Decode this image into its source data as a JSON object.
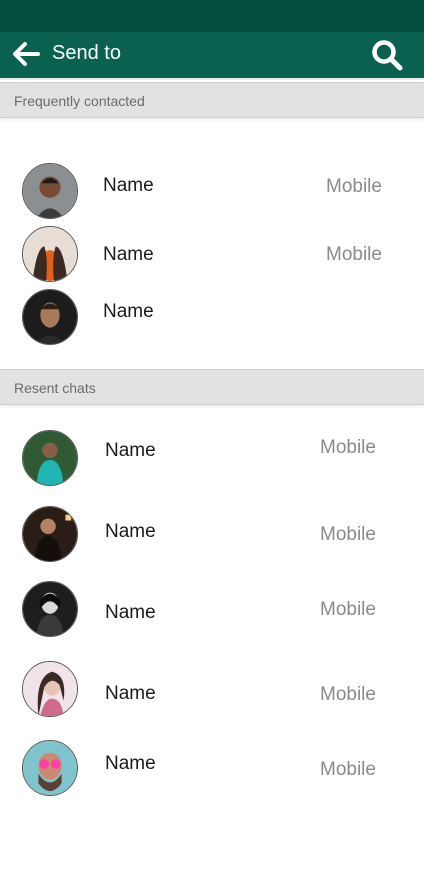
{
  "header": {
    "title": "Send to"
  },
  "sections": {
    "frequent_title": "Frequently contacted",
    "recent_title": "Resent chats"
  },
  "frequent": [
    {
      "name": "Name",
      "phone_type": "Mobile"
    },
    {
      "name": "Name",
      "phone_type": "Mobile"
    },
    {
      "name": "Name"
    }
  ],
  "recent": [
    {
      "name": "Name",
      "phone_type": "Mobile"
    },
    {
      "name": "Name",
      "phone_type": "Mobile"
    },
    {
      "name": "Name",
      "phone_type": "Mobile"
    },
    {
      "name": "Name",
      "phone_type": "Mobile"
    },
    {
      "name": "Name",
      "phone_type": "Mobile"
    }
  ],
  "colors": {
    "status_bar": "#044c3c",
    "app_bar": "#0b6150",
    "section_bg": "#e2e2e2"
  },
  "icons": {
    "back": "arrow-left-icon",
    "search": "search-icon"
  }
}
